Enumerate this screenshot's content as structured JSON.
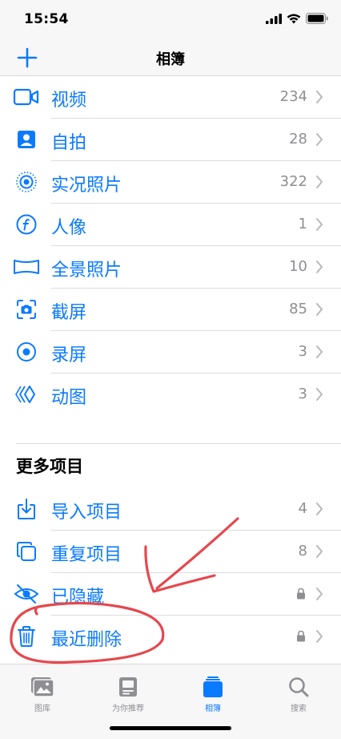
{
  "status_bar": {
    "time": "15:54"
  },
  "nav": {
    "title": "相簿"
  },
  "media_types": [
    {
      "icon": "video-icon",
      "label": "视频",
      "count": "234"
    },
    {
      "icon": "portrait-selfie-icon",
      "label": "自拍",
      "count": "28"
    },
    {
      "icon": "live-photo-icon",
      "label": "实况照片",
      "count": "322"
    },
    {
      "icon": "portrait-f-icon",
      "label": "人像",
      "count": "1"
    },
    {
      "icon": "panorama-icon",
      "label": "全景照片",
      "count": "10"
    },
    {
      "icon": "screenshot-icon",
      "label": "截屏",
      "count": "85"
    },
    {
      "icon": "screen-recording-icon",
      "label": "录屏",
      "count": "3"
    },
    {
      "icon": "animated-icon",
      "label": "动图",
      "count": "3"
    }
  ],
  "more": {
    "title": "更多项目",
    "items": [
      {
        "icon": "import-icon",
        "label": "导入项目",
        "count": "4"
      },
      {
        "icon": "duplicates-icon",
        "label": "重复项目",
        "count": "8"
      },
      {
        "icon": "hidden-eye-icon",
        "label": "已隐藏",
        "locked": true
      },
      {
        "icon": "trash-icon",
        "label": "最近删除",
        "locked": true
      }
    ]
  },
  "tabs": [
    {
      "label": "图库",
      "active": false
    },
    {
      "label": "为你推荐",
      "active": false
    },
    {
      "label": "相簿",
      "active": true
    },
    {
      "label": "搜索",
      "active": false
    }
  ],
  "colors": {
    "accent": "#0a7aff",
    "secondary_text": "#8e8e93",
    "annotation": "#e5484d"
  }
}
